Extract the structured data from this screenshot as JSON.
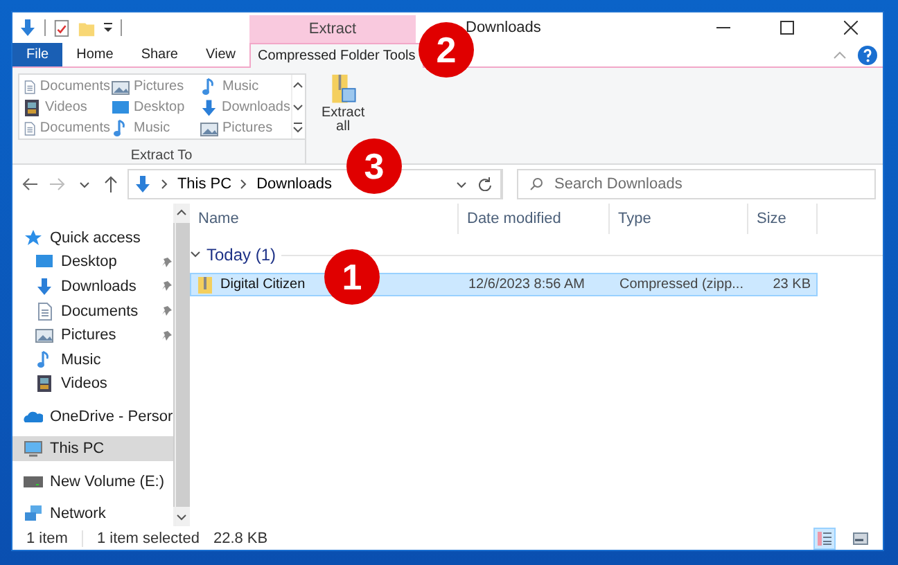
{
  "window": {
    "title": "Downloads"
  },
  "quick_toolbar": [
    {
      "kind": "properties"
    },
    {
      "kind": "folder"
    },
    {
      "kind": "customize"
    }
  ],
  "contextual_tab": {
    "label": "Extract"
  },
  "tabs": [
    {
      "label": "File",
      "kind": "file",
      "selected": false
    },
    {
      "label": "Home",
      "kind": "tab",
      "selected": false
    },
    {
      "label": "Share",
      "kind": "tab",
      "selected": false
    },
    {
      "label": "View",
      "kind": "tab",
      "selected": false
    },
    {
      "label": "Compressed Folder Tools",
      "kind": "tab",
      "selected": true
    }
  ],
  "ribbon": {
    "gallery": [
      {
        "label": "Documents",
        "kind": "document"
      },
      {
        "label": "Pictures",
        "kind": "picture"
      },
      {
        "label": "Music",
        "kind": "music"
      },
      {
        "label": "Videos",
        "kind": "video"
      },
      {
        "label": "Desktop",
        "kind": "desktop"
      },
      {
        "label": "Downloads",
        "kind": "download"
      },
      {
        "label": "Documents",
        "kind": "document"
      },
      {
        "label": "Music",
        "kind": "music"
      },
      {
        "label": "Pictures",
        "kind": "picture"
      }
    ],
    "group_label": "Extract To",
    "extract_button": "Extract\nall"
  },
  "address": {
    "path": [
      "This PC",
      "Downloads"
    ],
    "search_placeholder": "Search Downloads"
  },
  "sidebar": [
    {
      "label": "Quick access",
      "kind": "star",
      "selected": false,
      "children": [
        {
          "label": "Desktop",
          "kind": "desktop",
          "pinned": true,
          "selected": false
        },
        {
          "label": "Downloads",
          "kind": "download",
          "pinned": true,
          "selected": false
        },
        {
          "label": "Documents",
          "kind": "document",
          "pinned": true,
          "selected": false
        },
        {
          "label": "Pictures",
          "kind": "picture",
          "pinned": true,
          "selected": false
        },
        {
          "label": "Music",
          "kind": "music",
          "pinned": false,
          "selected": false
        },
        {
          "label": "Videos",
          "kind": "video",
          "pinned": false,
          "selected": false
        }
      ]
    },
    {
      "label": "OneDrive - Persor",
      "kind": "cloud",
      "selected": false
    },
    {
      "label": "This PC",
      "kind": "pc",
      "selected": true
    },
    {
      "label": "New Volume (E:)",
      "kind": "drive",
      "selected": false
    },
    {
      "label": "Network",
      "kind": "network",
      "selected": false
    }
  ],
  "table": {
    "columns": [
      "Name",
      "Date modified",
      "Type",
      "Size"
    ],
    "groups": [
      {
        "label": "Today (1)",
        "rows": [
          {
            "name": "Digital Citizen",
            "date": "12/6/2023 8:56 AM",
            "type": "Compressed (zipp...",
            "size": "23 KB",
            "selected": true
          }
        ]
      }
    ]
  },
  "status_bar": {
    "count": "1 item",
    "selection": "1 item selected",
    "size": "22.8 KB"
  },
  "view_buttons": [
    {
      "kind": "details",
      "selected": true
    },
    {
      "kind": "large",
      "selected": false
    }
  ],
  "markers": [
    {
      "label": "1"
    },
    {
      "label": "2"
    },
    {
      "label": "3"
    }
  ]
}
